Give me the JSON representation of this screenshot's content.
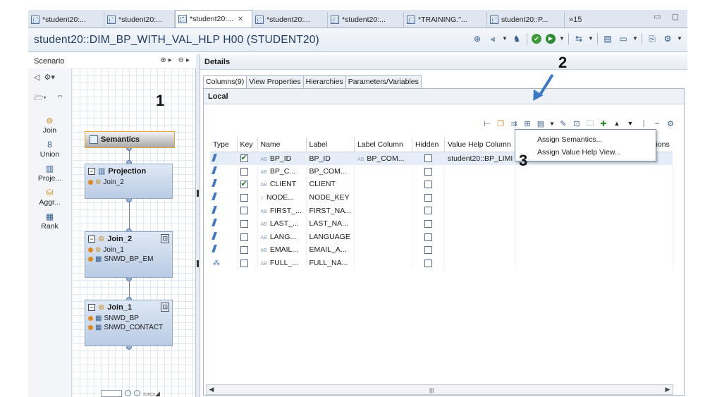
{
  "tabs": [
    {
      "label": "*student20:..."
    },
    {
      "label": "*student20:..."
    },
    {
      "label": "*student20:..."
    },
    {
      "label": "*student20:..."
    },
    {
      "label": "*student20:..."
    },
    {
      "label": "*TRAINING.\"..."
    },
    {
      "label": "student20::P..."
    },
    {
      "label": "»15"
    }
  ],
  "editor": {
    "title": "student20::DIM_BP_WITH_VAL_HLP H00 (STUDENT20)"
  },
  "scenario": {
    "label": "Scenario",
    "palette": [
      {
        "label": "Join",
        "icon": "join-icon"
      },
      {
        "label": "Union",
        "icon": "union-icon"
      },
      {
        "label": "Proje...",
        "icon": "projection-icon"
      },
      {
        "label": "Aggr...",
        "icon": "aggregation-icon"
      },
      {
        "label": "Rank",
        "icon": "rank-icon"
      }
    ],
    "nodes": {
      "semantics": "Semantics",
      "projection": "Projection",
      "projection_input": "Join_2",
      "join2": "Join_2",
      "join2_inputs": [
        "Join_1",
        "SNWD_BP_EM"
      ],
      "join1": "Join_1",
      "join1_inputs": [
        "SNWD_BP",
        "SNWD_CONTACT"
      ]
    }
  },
  "details": {
    "header": "Details",
    "subtabs": [
      "Columns(9)",
      "View Properties",
      "Hierarchies",
      "Parameters/Variables"
    ],
    "section": "Local",
    "columns": [
      "Type",
      "Key",
      "Name",
      "Label",
      "Label Column",
      "Hidden",
      "Value Help Column",
      "tions"
    ],
    "rows": [
      {
        "key": true,
        "name": "BP_ID",
        "label": "BP_ID",
        "label_column": "BP_COM...",
        "hidden": false,
        "value_help": "student20::BP_LIMI"
      },
      {
        "key": false,
        "name": "BP_C...",
        "label": "BP_COM...",
        "label_column": "",
        "hidden": false,
        "value_help": ""
      },
      {
        "key": true,
        "name": "CLIENT",
        "label": "CLIENT",
        "label_column": "",
        "hidden": false,
        "value_help": ""
      },
      {
        "key": false,
        "name": "NODE...",
        "label": "NODE_KEY",
        "label_column": "",
        "hidden": false,
        "value_help": ""
      },
      {
        "key": false,
        "name": "FIRST_...",
        "label": "FIRST_NA...",
        "label_column": "",
        "hidden": false,
        "value_help": ""
      },
      {
        "key": false,
        "name": "LAST_...",
        "label": "LAST_NA...",
        "label_column": "",
        "hidden": false,
        "value_help": ""
      },
      {
        "key": false,
        "name": "LANG...",
        "label": "LANGUAGE",
        "label_column": "",
        "hidden": false,
        "value_help": ""
      },
      {
        "key": false,
        "name": "EMAIL...",
        "label": "EMAIL_A...",
        "label_column": "",
        "hidden": false,
        "value_help": ""
      },
      {
        "key": false,
        "name": "FULL_...",
        "label": "FULL_NA...",
        "label_column": "",
        "hidden": false,
        "value_help": ""
      }
    ],
    "menu": [
      "Assign Semantics...",
      "Assign Value Help View..."
    ]
  },
  "annotations": [
    "1",
    "2",
    "3"
  ]
}
